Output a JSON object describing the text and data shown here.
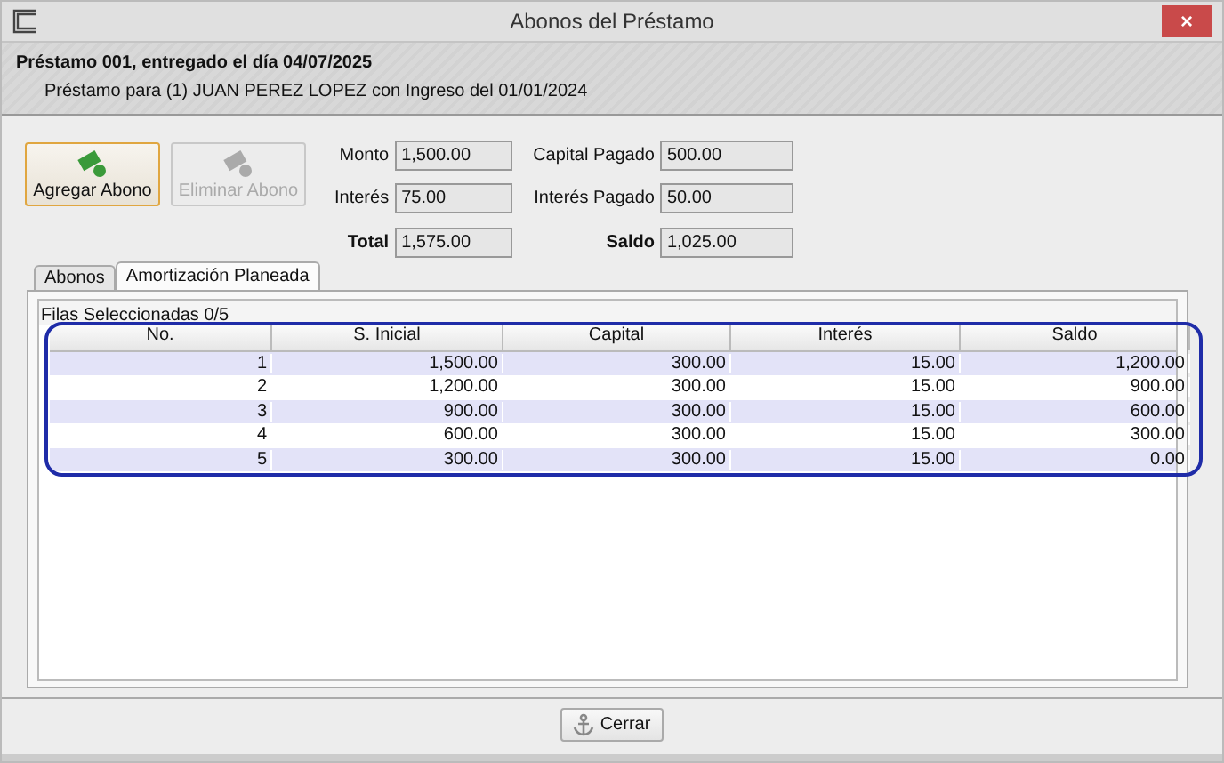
{
  "window": {
    "title": "Abonos del Préstamo",
    "close": "×"
  },
  "header": {
    "title": "Préstamo 001, entregado el día 04/07/2025",
    "subtitle": "Préstamo para (1) JUAN PEREZ LOPEZ con Ingreso del 01/01/2024"
  },
  "actions": [
    {
      "label": "Agregar Abono",
      "disabled": false
    },
    {
      "label": "Eliminar Abono",
      "disabled": true
    }
  ],
  "fields": [
    {
      "label": "Monto",
      "value": "1,500.00",
      "bold": false
    },
    {
      "label": "Capital Pagado",
      "value": "500.00",
      "bold": false
    },
    {
      "label": "Interés",
      "value": "75.00",
      "bold": false
    },
    {
      "label": "Interés Pagado",
      "value": "50.00",
      "bold": false
    },
    {
      "label": "Total",
      "value": "1,575.00",
      "bold": true
    },
    {
      "label": "Saldo",
      "value": "1,025.00",
      "bold": true
    }
  ],
  "tabs": [
    {
      "label": "Abonos",
      "selected": false
    },
    {
      "label": "Amortización Planeada",
      "selected": true
    }
  ],
  "table": {
    "selection_info": "Filas Seleccionadas 0/5",
    "columns": [
      "No.",
      "S. Inicial",
      "Capital",
      "Interés",
      "Saldo"
    ],
    "rows": [
      [
        "1",
        "1,500.00",
        "300.00",
        "15.00",
        "1,200.00"
      ],
      [
        "2",
        "1,200.00",
        "300.00",
        "15.00",
        "900.00"
      ],
      [
        "3",
        "900.00",
        "300.00",
        "15.00",
        "600.00"
      ],
      [
        "4",
        "600.00",
        "300.00",
        "15.00",
        "300.00"
      ],
      [
        "5",
        "300.00",
        "300.00",
        "15.00",
        "0.00"
      ]
    ]
  },
  "footer": {
    "button": "Cerrar"
  }
}
